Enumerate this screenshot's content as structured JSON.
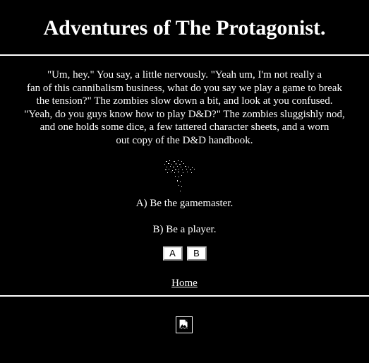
{
  "header": {
    "title": "Adventures of The Protagonist."
  },
  "story": {
    "lines": [
      "\"Um, hey.\" You say, a little nervously. \"Yeah um, I'm not really a",
      "fan of this cannibalism business, what do you say we play a game to break",
      "the tension?\" The zombies slow down a bit, and look at you confused.",
      "\"Yeah, do you guys know how to play D&D?\" The zombies sluggishly nod,",
      "and one holds some dice, a few tattered character sheets, and a worn",
      "out copy of the D&D handbook."
    ]
  },
  "choices": {
    "a_text": "A) Be the gamemaster.",
    "b_text": "B) Be a player.",
    "a_button": "A",
    "b_button": "B"
  },
  "nav": {
    "home": "Home"
  },
  "icons": {
    "story_image": "zombie-sketch-image",
    "footer": "broken-image-icon"
  },
  "colors": {
    "background": "#000000",
    "text": "#ffffff"
  }
}
